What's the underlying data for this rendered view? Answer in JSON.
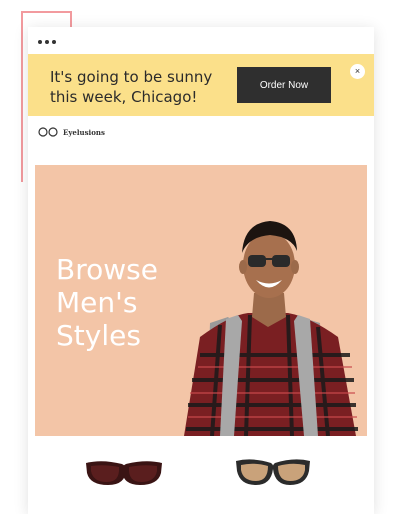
{
  "banner": {
    "message_line1": "It's going to be sunny",
    "message_line2": "this week, Chicago!",
    "order_button_label": "Order Now",
    "close_symbol": "×"
  },
  "brand": {
    "name": "Eyelusions",
    "logo_icon": "glasses-outline-icon"
  },
  "hero": {
    "title_lines": [
      "Browse",
      "Men's",
      "Styles"
    ],
    "background_color": "#f3c5a7"
  },
  "colors": {
    "banner_background": "#fbe08a",
    "button_background": "#2f2f2f",
    "accent_frame": "#f29a9e"
  },
  "products": [
    {
      "icon": "sunglasses-dark-icon"
    },
    {
      "icon": "sunglasses-cat-eye-icon"
    }
  ]
}
